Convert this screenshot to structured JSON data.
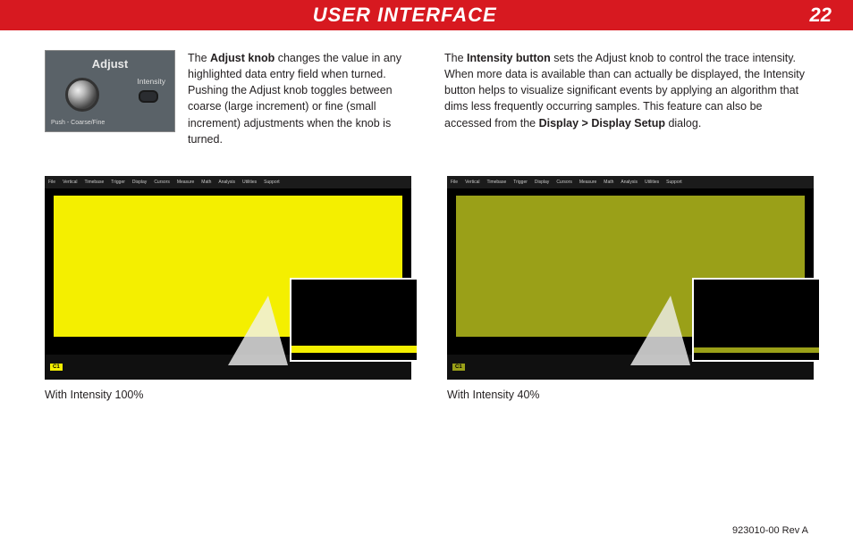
{
  "header": {
    "title": "USER INTERFACE",
    "page": "22"
  },
  "hardware": {
    "adjust_label": "Adjust",
    "intensity_label": "Intensity",
    "push_label": "Push - Coarse/Fine"
  },
  "text": {
    "left_bold1": "Adjust knob",
    "left_pre1": "The ",
    "left_post1": " changes the value in any highlighted data entry field when turned. Pushing the Adjust knob toggles between coarse (large increment) or fine (small increment) adjustments when the knob is turned.",
    "right_pre1": "The ",
    "right_bold1": "Intensity button",
    "right_post1": " sets the Adjust knob to control the trace intensity. When more data is available than can actually be displayed, the Intensity button helps to visualize significant events by applying an algorithm that dims less frequently occurring samples. This feature can also be accessed from the ",
    "right_bold2": "Display > Display Setup",
    "right_post2": " dialog."
  },
  "scope_menu_items": [
    "File",
    "Vertical",
    "Timebase",
    "Trigger",
    "Display",
    "Cursors",
    "Measure",
    "Math",
    "Analysis",
    "Utilities",
    "Support"
  ],
  "captions": {
    "left": "With Intensity 100%",
    "right": "With Intensity 40%"
  },
  "footer": {
    "rev": "923010-00 Rev A"
  },
  "scope_badge": "C1"
}
